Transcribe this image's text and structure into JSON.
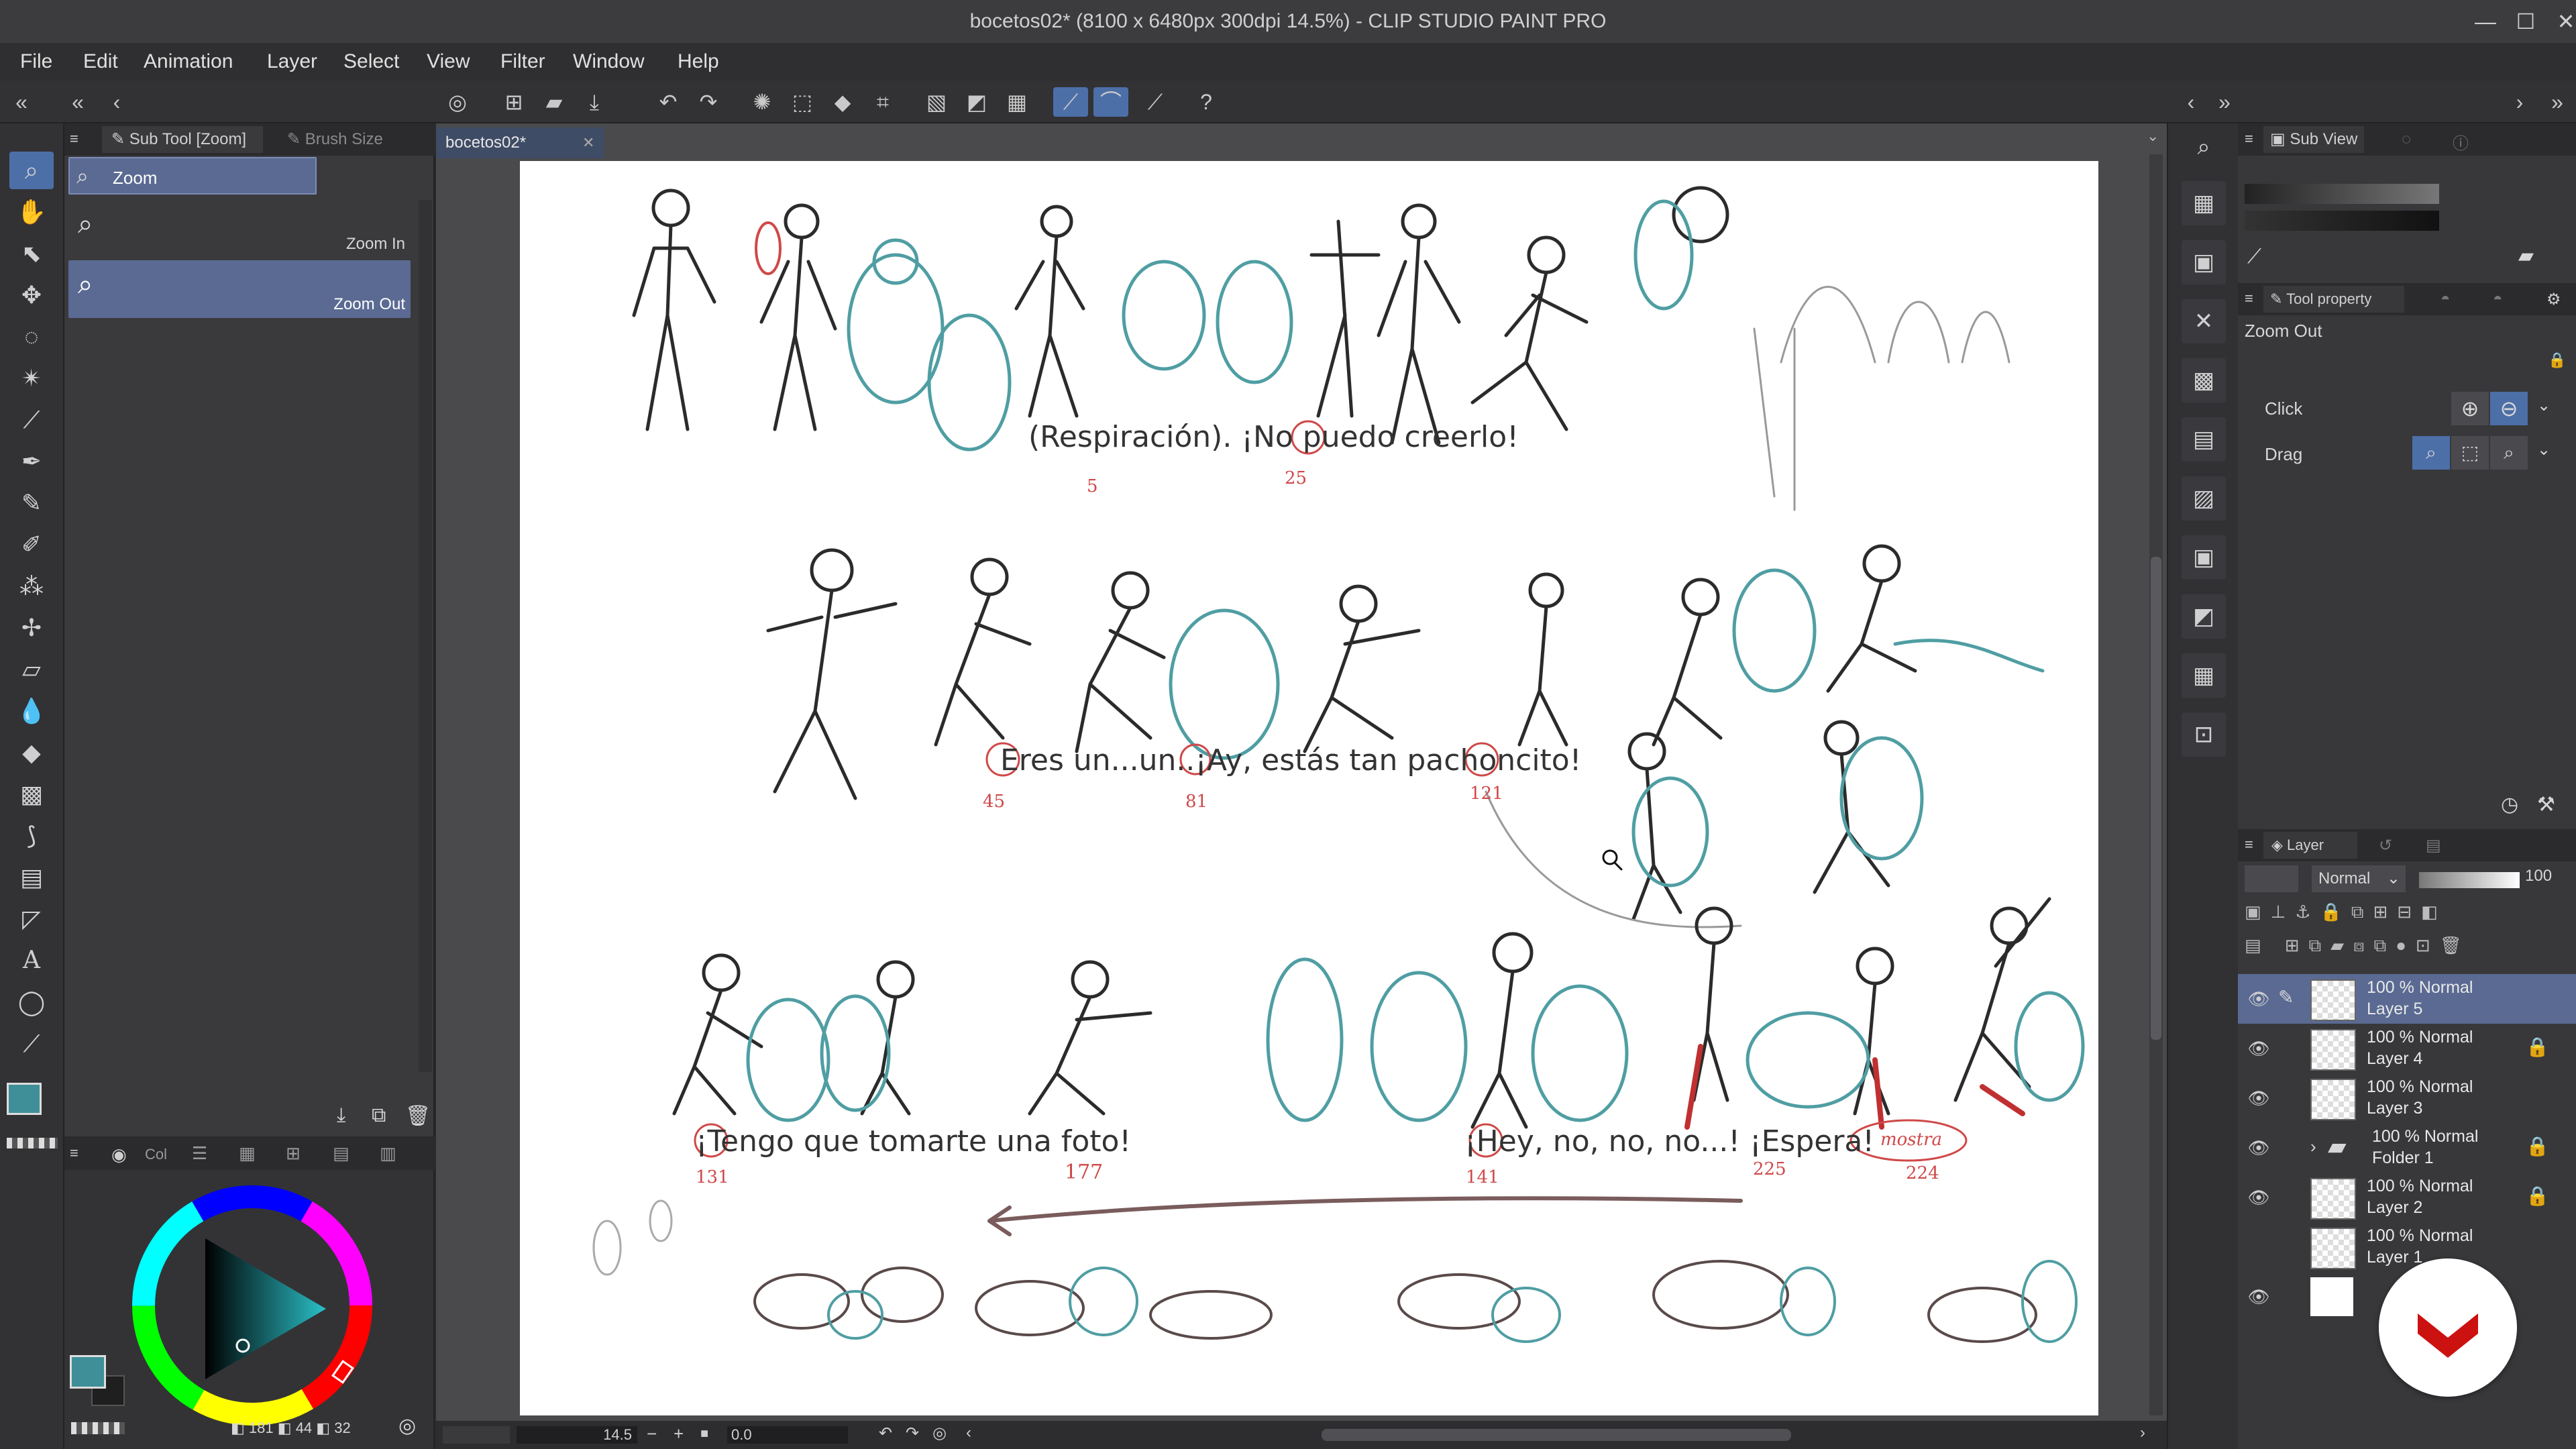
{
  "window": {
    "title": "bocetos02* (8100 x 6480px 300dpi 14.5%)  - CLIP STUDIO PAINT PRO",
    "minimize": "—",
    "maximize": "☐",
    "close": "✕"
  },
  "menu": [
    "File",
    "Edit",
    "Animation",
    "Layer",
    "Select",
    "View",
    "Filter",
    "Window",
    "Help"
  ],
  "subtool_panel": {
    "tab_active": "Sub Tool [Zoom]",
    "tab_inactive": "Brush Size",
    "group": "Zoom",
    "items": [
      {
        "label": "Zoom In"
      },
      {
        "label": "Zoom Out"
      }
    ]
  },
  "color_panel": {
    "tab": "Col",
    "status": {
      "a": "181",
      "b": "44",
      "c": "32"
    },
    "main_color": "#3f8f98",
    "sub_color": "#1f1f1f"
  },
  "canvas": {
    "tab": "bocetos02*",
    "dialogue": [
      "(Respiración). ¡No puedo creerlo!",
      "Eres un...un..¡Ay, estás tan pachoncito!",
      "¡Tengo que tomarte una foto!",
      "¡Hey, no, no, no...! ¡Espera!"
    ],
    "red_notes": [
      "5",
      "25",
      "45",
      "81",
      "121",
      "131",
      "177",
      "141",
      "225",
      "224",
      "mostra"
    ]
  },
  "status_bar": {
    "zoom": "14.5",
    "angle": "0.0"
  },
  "sub_view": {
    "tab": "Sub View"
  },
  "tool_property": {
    "tab": "Tool property",
    "tool_name": "Zoom Out",
    "click_label": "Click",
    "drag_label": "Drag"
  },
  "layer_panel": {
    "tab": "Layer",
    "blend_mode": "Normal",
    "opacity": "100",
    "layers": [
      {
        "mode": "100 % Normal",
        "name": "Layer 5",
        "selected": true,
        "locked": false
      },
      {
        "mode": "100 % Normal",
        "name": "Layer 4",
        "selected": false,
        "locked": true
      },
      {
        "mode": "100 % Normal",
        "name": "Layer 3",
        "selected": false,
        "locked": false
      },
      {
        "mode": "100 % Normal",
        "name": "Folder 1",
        "selected": false,
        "locked": true
      },
      {
        "mode": "100 % Normal",
        "name": "Layer 2",
        "selected": false,
        "locked": true
      },
      {
        "mode": "100 % Normal",
        "name": "Layer 1",
        "selected": false,
        "locked": false
      }
    ]
  },
  "colors": {
    "accent": "#4d6fa8",
    "sketch_teal": "#4f9ea3",
    "sketch_red": "#d04848",
    "watermark": "#cc1111"
  }
}
